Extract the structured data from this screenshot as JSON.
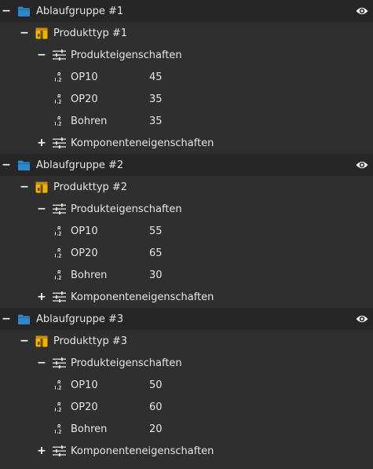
{
  "colors": {
    "folder": "#2d88c9",
    "product": "#f1b300",
    "background": "#2f2f2f",
    "group_background": "#262626"
  },
  "groups": [
    {
      "label": "Ablaufgruppe #1",
      "expanded_symbol": "−",
      "product": {
        "label": "Produkttyp #1",
        "expanded_symbol": "−",
        "properties": {
          "label": "Produkteigenschaften",
          "expanded_symbol": "−",
          "items": [
            {
              "name": "OP10",
              "value": "45"
            },
            {
              "name": "OP20",
              "value": "35"
            },
            {
              "name": "Bohren",
              "value": "35"
            }
          ]
        },
        "components": {
          "label": "Komponenteneigenschaften",
          "collapsed_symbol": "+"
        }
      }
    },
    {
      "label": "Ablaufgruppe #2",
      "expanded_symbol": "−",
      "product": {
        "label": "Produkttyp #2",
        "expanded_symbol": "−",
        "properties": {
          "label": "Produkteigenschaften",
          "expanded_symbol": "−",
          "items": [
            {
              "name": "OP10",
              "value": "55"
            },
            {
              "name": "OP20",
              "value": "65"
            },
            {
              "name": "Bohren",
              "value": "30"
            }
          ]
        },
        "components": {
          "label": "Komponenteneigenschaften",
          "collapsed_symbol": "+"
        }
      }
    },
    {
      "label": "Ablaufgruppe #3",
      "expanded_symbol": "−",
      "product": {
        "label": "Produkttyp #3",
        "expanded_symbol": "−",
        "properties": {
          "label": "Produkteigenschaften",
          "expanded_symbol": "−",
          "items": [
            {
              "name": "OP10",
              "value": "50"
            },
            {
              "name": "OP20",
              "value": "60"
            },
            {
              "name": "Bohren",
              "value": "20"
            }
          ]
        },
        "components": {
          "label": "Komponenteneigenschaften",
          "collapsed_symbol": "+"
        }
      }
    }
  ]
}
